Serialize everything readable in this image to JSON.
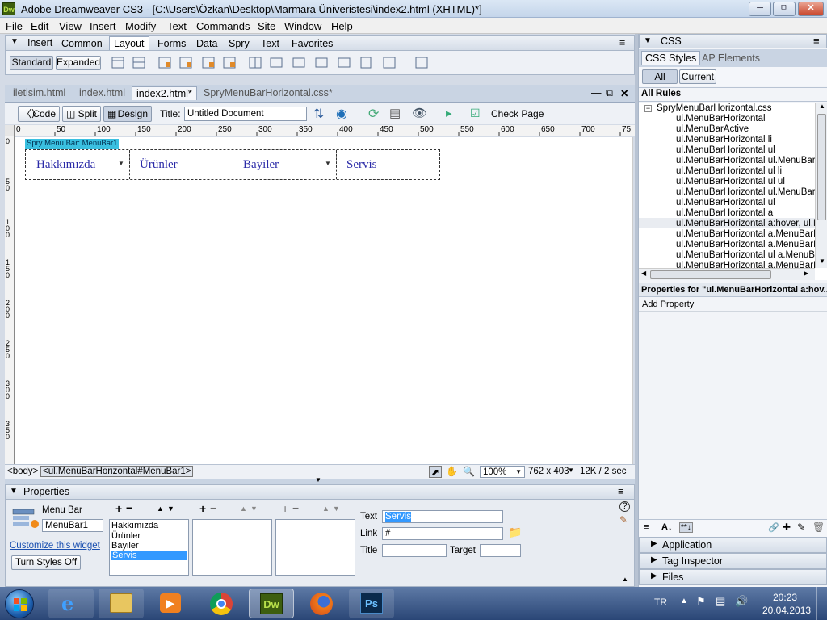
{
  "window": {
    "title": "Adobe Dreamweaver CS3 - [C:\\Users\\Özkan\\Desktop\\Marmara Üniveristesi\\index2.html (XHTML)*]",
    "logo": "Dw",
    "buttons": [
      "minimize",
      "restore",
      "close"
    ]
  },
  "menu": [
    "File",
    "Edit",
    "View",
    "Insert",
    "Modify",
    "Text",
    "Commands",
    "Site",
    "Window",
    "Help"
  ],
  "insert_bar": {
    "title": "Insert",
    "tabs": [
      "Common",
      "Layout",
      "Forms",
      "Data",
      "Spry",
      "Text",
      "Favorites"
    ],
    "active_tab": "Layout",
    "mode_buttons": [
      "Standard",
      "Expanded"
    ],
    "active_mode": "Standard"
  },
  "doc_tabs": [
    "iletisim.html",
    "index.html",
    "index2.html*",
    "SpryMenuBarHorizontal.css*"
  ],
  "doc_toolbar": {
    "views": [
      "Code",
      "Split",
      "Design"
    ],
    "active_view": "Design",
    "title_label": "Title:",
    "title_value": "Untitled Document",
    "check_page": "Check Page"
  },
  "ruler": {
    "top_ticks": [
      "0",
      "50",
      "100",
      "150",
      "200",
      "250",
      "300",
      "350",
      "400",
      "450",
      "500",
      "550",
      "600",
      "650",
      "700",
      "75"
    ],
    "left_ticks": [
      "0",
      "5 0",
      "1 0 0",
      "1 5 0",
      "2 0 0",
      "2 5 0",
      "3 0 0",
      "3 5 0"
    ]
  },
  "canvas": {
    "widget_tag": "Spry Menu Bar: MenuBar1",
    "menu_items": [
      {
        "label": "Hakkımızda",
        "has_submenu": true
      },
      {
        "label": "Ürünler",
        "has_submenu": false
      },
      {
        "label": "Bayiler",
        "has_submenu": true
      },
      {
        "label": "Servis",
        "has_submenu": false
      }
    ]
  },
  "status": {
    "tags": [
      "<body>",
      "<ul.MenuBarHorizontal#MenuBar1>"
    ],
    "zoom": "100%",
    "size": "762 x 403",
    "download": "12K / 2 sec"
  },
  "properties": {
    "title": "Properties",
    "widget_label": "Menu Bar",
    "widget_id": "MenuBar1",
    "customize_link": "Customize this widget",
    "turn_styles_off": "Turn Styles Off",
    "list1": [
      "Hakkımızda",
      "Ürünler",
      "Bayiler",
      "Servis"
    ],
    "list1_selected": "Servis",
    "text_label": "Text",
    "text_value": "Servis",
    "link_label": "Link",
    "link_value": "#",
    "title_label": "Title",
    "title_value": "",
    "target_label": "Target",
    "target_value": ""
  },
  "css_panel": {
    "title": "CSS",
    "tabs": [
      "CSS Styles",
      "AP Elements"
    ],
    "active_tab": "CSS Styles",
    "toggle": [
      "All",
      "Current"
    ],
    "active_toggle": "All",
    "all_rules_label": "All Rules",
    "file": "SpryMenuBarHorizontal.css",
    "rules": [
      "ul.MenuBarHorizontal",
      "ul.MenuBarActive",
      "ul.MenuBarHorizontal li",
      "ul.MenuBarHorizontal ul",
      "ul.MenuBarHorizontal ul.MenuBarSu",
      "ul.MenuBarHorizontal ul li",
      "ul.MenuBarHorizontal ul ul",
      "ul.MenuBarHorizontal ul.MenuBarSu",
      "ul.MenuBarHorizontal ul",
      "ul.MenuBarHorizontal a",
      "ul.MenuBarHorizontal a:hover, ul.M",
      "ul.MenuBarHorizontal a.MenuBarIte",
      "ul.MenuBarHorizontal a.MenuBarIte",
      "ul.MenuBarHorizontal ul a.MenuBar",
      "ul.MenuBarHorizontal a.MenuBarIte"
    ],
    "selected_rule_index": 10,
    "properties_for": "Properties for \"ul.MenuBarHorizontal a:hov...",
    "add_property": "Add Property"
  },
  "collapsed_panels": [
    "Application",
    "Tag Inspector",
    "Files"
  ],
  "taskbar": {
    "apps": [
      "ie",
      "explorer",
      "media",
      "chrome",
      "dreamweaver",
      "firefox",
      "photoshop"
    ],
    "lang": "TR",
    "time": "20:23",
    "date": "20.04.2013"
  }
}
